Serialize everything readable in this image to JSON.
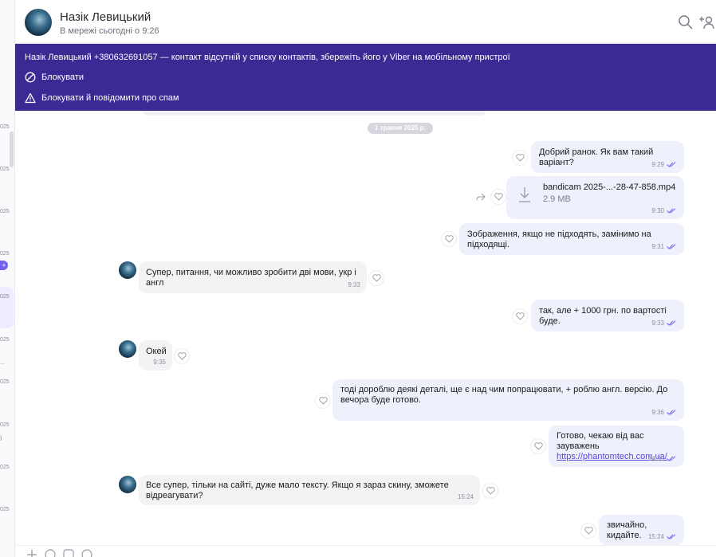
{
  "contact": {
    "name": "Назік Левицький",
    "status": "В мережі сьогодні о 9:26"
  },
  "banner": {
    "text": "Назік Левицький +380632691057 — контакт відсутній у списку контактів, збережіть його у Viber на мобільному пристрої",
    "block_label": "Блокувати",
    "report_label": "Блокувати й повідомити про спам"
  },
  "date_separator": "1 травня 2025 р.",
  "chat_list_strip": [
    "025",
    "025",
    "025",
    "025",
    "025",
    "025",
    "...",
    "025",
    "025",
    "ї",
    "025",
    "025"
  ],
  "messages": [
    {
      "dir": "out",
      "text": "Добрий ранок. Як вам такий варіант?",
      "time": "9:29",
      "read": true
    },
    {
      "dir": "out",
      "type": "file",
      "file_name": "bandicam 2025-...-28-47-858.mp4",
      "file_size": "2.9 MB",
      "time": "9:30",
      "read": true
    },
    {
      "dir": "out",
      "text": "Зображення, якщо не підходять, замінимо на підходящі.",
      "time": "9:31",
      "read": true
    },
    {
      "dir": "in",
      "text": "Супер, питання, чи можливо зробити дві мови, укр і англ",
      "time": "9:33"
    },
    {
      "dir": "out",
      "text": "так, але + 1000 грн. по вартості буде.",
      "time": "9:33",
      "read": true
    },
    {
      "dir": "in",
      "text": "Окей",
      "time": "9:35"
    },
    {
      "dir": "out",
      "text": "тоді дороблю деякі деталі, ще є над чим попрацювати, + роблю англ. версію. До вечора буде готово.",
      "time": "9:36",
      "read": true
    },
    {
      "dir": "out",
      "text": "Готово, чекаю від вас зауважень",
      "link": "https://phantomtech.com.ua/",
      "time": "14:59",
      "read": true
    },
    {
      "dir": "in",
      "text": "Все супер, тільки на сайті, дуже мало тексту. Якщо я зараз скину, зможете відреагувати?",
      "time": "15:24"
    },
    {
      "dir": "out",
      "text": "звичайно, кидайте.",
      "time": "15:24",
      "read": true
    }
  ],
  "icons": {
    "search": "search-icon",
    "add_participant": "add-user-icon",
    "block": "block-icon",
    "report": "warning-icon",
    "like": "heart-icon",
    "share": "share-icon",
    "download": "download-icon",
    "read_receipt": "double-check-icon"
  },
  "colors": {
    "accent": "#3a2a93",
    "viber_purple": "#7360f2",
    "outgoing_bubble": "#eef1fb",
    "incoming_bubble": "#f3f3f6"
  }
}
